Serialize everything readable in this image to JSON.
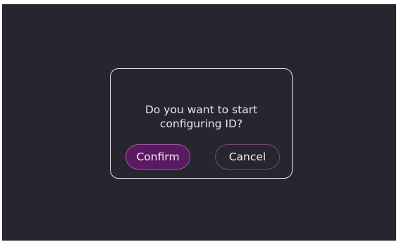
{
  "dialog": {
    "message": "Do you want to start configuring ID?",
    "confirm_label": "Confirm",
    "cancel_label": "Cancel"
  },
  "colors": {
    "background": "#272530",
    "dialog_border": "#e6e4ea",
    "confirm_fill": "#5a1a62",
    "confirm_border": "#9a5aa2",
    "cancel_border": "#6e4a72",
    "text": "#e9e7ee"
  }
}
